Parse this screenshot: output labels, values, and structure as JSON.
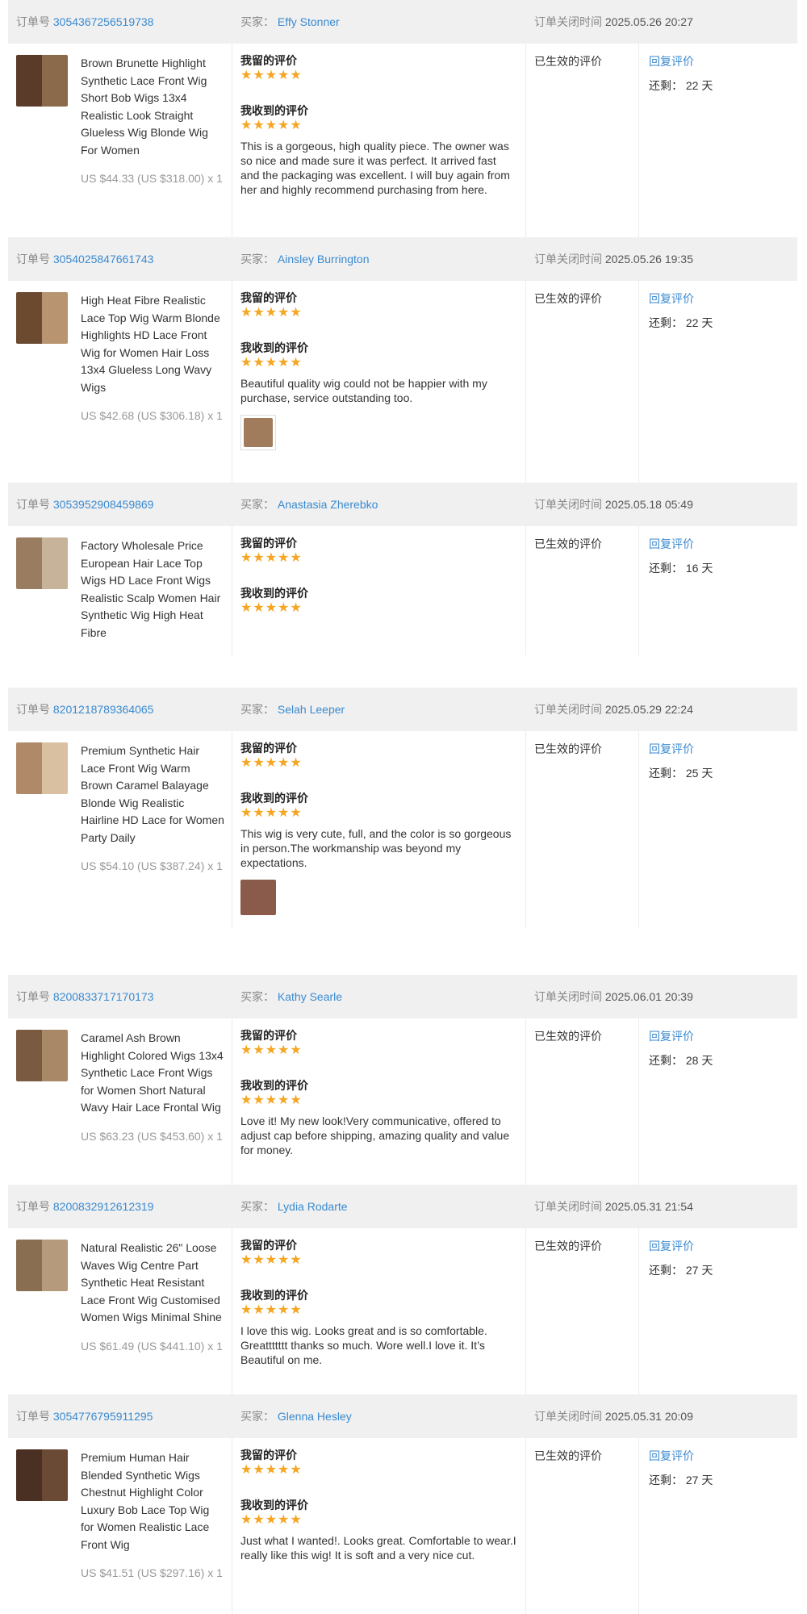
{
  "labels": {
    "order_no": "订单号",
    "buyer": "买家：",
    "close_time": "订单关闭时间",
    "my_review": "我留的评价",
    "received_review": "我收到的评价",
    "status": "已生效的评价",
    "reply": "回复评价",
    "remaining": "还剩：",
    "stars": "★★★★★"
  },
  "orders": [
    {
      "order_no": "3054367256519738",
      "buyer": "Effy Stonner",
      "close_time": "2025.05.26 20:27",
      "title": "Brown Brunette Highlight Synthetic Lace Front Wig Short Bob Wigs 13x4 Realistic Look Straight Glueless Wig Blonde Wig For Women",
      "price": "US $44.33 (US $318.00) x 1",
      "review_text": "This is a gorgeous, high quality piece. The owner was so nice and made sure it was perfect. It arrived fast and the packaging was excellent. I will buy again from her and highly recommend purchasing from here.",
      "days": "22 天",
      "colors": [
        "#5a3a28",
        "#8a6a4a"
      ]
    },
    {
      "order_no": "3054025847661743",
      "buyer": "Ainsley Burrington",
      "close_time": "2025.05.26 19:35",
      "title": "High Heat Fibre Realistic Lace Top Wig Warm Blonde Highlights HD Lace Front Wig for Women Hair Loss 13x4 Glueless Long Wavy Wigs",
      "price": "US $42.68 (US $306.18) x 1",
      "review_text": "Beautiful quality wig could not be happier with my purchase, service outstanding too.",
      "days": "22 天",
      "colors": [
        "#6b4a30",
        "#b89470"
      ]
    },
    {
      "order_no": "3053952908459869",
      "buyer": "Anastasia Zherebko",
      "close_time": "2025.05.18 05:49",
      "title": "Factory Wholesale Price European Hair Lace Top Wigs HD Lace Front Wigs Realistic Scalp Women Hair Synthetic Wig High Heat Fibre",
      "price": "",
      "review_text": "",
      "days": "16 天",
      "colors": [
        "#9a7d60",
        "#c7b39a"
      ]
    },
    {
      "order_no": "8201218789364065",
      "buyer": "Selah Leeper",
      "close_time": "2025.05.29 22:24",
      "title": "Premium Synthetic Hair Lace Front Wig Warm Brown Caramel Balayage Blonde Wig Realistic Hairline HD Lace for Women Party Daily",
      "price": "US $54.10 (US $387.24) x 1",
      "review_text": "This wig is very cute, full, and the color is so gorgeous in person.The workmanship was beyond my expectations.",
      "days": "25 天",
      "colors": [
        "#b08a68",
        "#d8c0a0"
      ]
    },
    {
      "order_no": "8200833717170173",
      "buyer": "Kathy Searle",
      "close_time": "2025.06.01 20:39",
      "title": "Caramel Ash Brown Highlight Colored Wigs 13x4 Synthetic Lace Front Wigs for Women Short Natural Wavy Hair Lace Frontal Wig",
      "price": "US $63.23 (US $453.60) x 1",
      "review_text": "Love it! My new look!Very communicative, offered to adjust cap before shipping, amazing quality and value for money.",
      "days": "28 天",
      "colors": [
        "#7a5a40",
        "#a88866"
      ]
    },
    {
      "order_no": "8200832912612319",
      "buyer": "Lydia Rodarte",
      "close_time": "2025.05.31 21:54",
      "title": "Natural Realistic 26\" Loose Waves Wig Centre Part Synthetic Heat Resistant Lace Front Wig Customised Women Wigs Minimal Shine",
      "price": "US $61.49 (US $441.10) x 1",
      "review_text": "I love this wig. Looks great and is so comfortable. Greattttttt thanks so much. Wore well.I love it. It’s Beautiful on me.",
      "days": "27 天",
      "colors": [
        "#8a6e52",
        "#b59a7c"
      ]
    },
    {
      "order_no": "3054776795911295",
      "buyer": "Glenna Hesley",
      "close_time": "2025.05.31 20:09",
      "title": "Premium Human Hair Blended Synthetic Wigs Chestnut Highlight Color Luxury Bob Lace Top Wig for Women Realistic Lace Front Wig",
      "price": "US $41.51 (US $297.16) x 1",
      "review_text": "Just what I wanted!. Looks great. Comfortable to wear.I really like this wig! It is soft and a very nice cut.",
      "days": "27 天",
      "colors": [
        "#4a3022",
        "#6a4a34"
      ]
    }
  ],
  "review_photo_colors": [
    "#a07c5c",
    "#8a5a4a"
  ]
}
